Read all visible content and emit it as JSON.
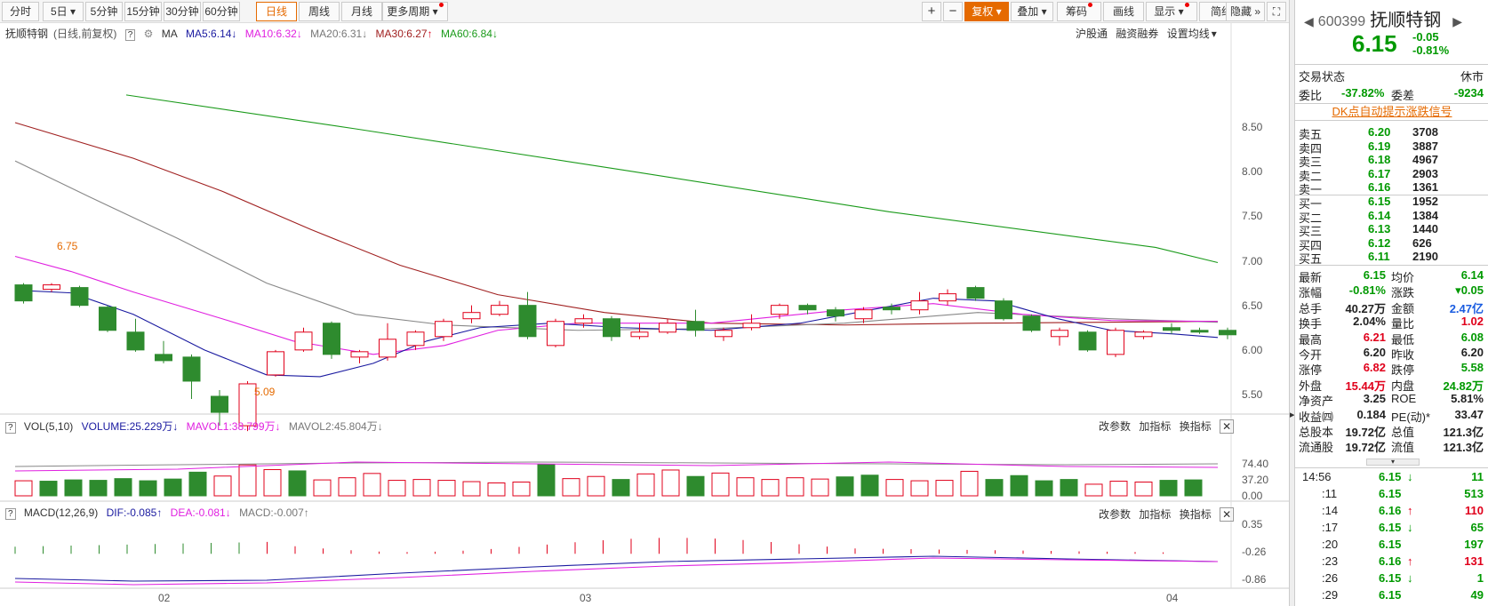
{
  "toolbar": {
    "periods": [
      "分时",
      "5日",
      "5分钟",
      "15分钟",
      "30分钟",
      "60分钟",
      "日线",
      "周线",
      "月线",
      "更多周期"
    ],
    "right_buttons": [
      "复权",
      "叠加",
      "筹码",
      "画线",
      "显示",
      "简约",
      "隐藏"
    ]
  },
  "main_legend": {
    "name": "抚顺特钢",
    "mode": "(日线,前复权)",
    "help": "?",
    "ma_label": "MA",
    "ma5": "MA5:6.14",
    "ma10": "MA10:6.32",
    "ma20": "MA20:6.31",
    "ma30": "MA30:6.27",
    "ma60": "MA60:6.84",
    "links": [
      "沪股通",
      "融资融券",
      "设置均线"
    ]
  },
  "price_axis": [
    "8.50",
    "8.00",
    "7.50",
    "7.00",
    "6.50",
    "6.00",
    "5.50"
  ],
  "annotations": {
    "high": "6.75",
    "low": "5.09"
  },
  "vol_legend": {
    "title": "VOL(5,10)",
    "volume": "VOLUME:25.229万",
    "mavol1": "MAVOL1:38.799万",
    "mavol2": "MAVOL2:45.804万",
    "buttons": [
      "改参数",
      "加指标",
      "换指标"
    ]
  },
  "vol_axis": [
    "74.40",
    "37.20",
    "0.00"
  ],
  "macd_legend": {
    "title": "MACD(12,26,9)",
    "dif": "DIF:-0.085",
    "dea": "DEA:-0.081",
    "macd": "MACD:-0.007",
    "buttons": [
      "改参数",
      "加指标",
      "换指标"
    ]
  },
  "macd_axis": [
    "0.35",
    "-0.26",
    "-0.86"
  ],
  "date_axis": [
    "02",
    "03",
    "04"
  ],
  "colors": {
    "up": "#e0001b",
    "down": "#2e8b2e",
    "ma5": "#1a1aa0",
    "ma10": "#e020e0",
    "ma20": "#888888",
    "ma30": "#a02020",
    "ma60": "#1a9a1a",
    "accent": "#e56a00"
  },
  "chart_data": {
    "type": "candlestick",
    "candles": [
      {
        "o": 6.73,
        "c": 6.55,
        "h": 6.75,
        "l": 6.52
      },
      {
        "o": 6.68,
        "c": 6.73,
        "h": 6.75,
        "l": 6.65
      },
      {
        "o": 6.7,
        "c": 6.5,
        "h": 6.72,
        "l": 6.48
      },
      {
        "o": 6.48,
        "c": 6.22,
        "h": 6.5,
        "l": 6.2
      },
      {
        "o": 6.2,
        "c": 6.0,
        "h": 6.35,
        "l": 5.98
      },
      {
        "o": 5.95,
        "c": 5.88,
        "h": 6.1,
        "l": 5.85
      },
      {
        "o": 5.92,
        "c": 5.65,
        "h": 5.95,
        "l": 5.45
      },
      {
        "o": 5.48,
        "c": 5.3,
        "h": 5.55,
        "l": 5.15
      },
      {
        "o": 5.15,
        "c": 5.62,
        "h": 5.65,
        "l": 5.09
      },
      {
        "o": 5.72,
        "c": 5.98,
        "h": 6.0,
        "l": 5.7
      },
      {
        "o": 6.0,
        "c": 6.2,
        "h": 6.25,
        "l": 5.98
      },
      {
        "o": 6.3,
        "c": 5.95,
        "h": 6.32,
        "l": 5.9
      },
      {
        "o": 5.92,
        "c": 5.98,
        "h": 6.0,
        "l": 5.85
      },
      {
        "o": 5.92,
        "c": 6.12,
        "h": 6.3,
        "l": 5.88
      },
      {
        "o": 6.05,
        "c": 6.2,
        "h": 6.22,
        "l": 6.0
      },
      {
        "o": 6.15,
        "c": 6.32,
        "h": 6.35,
        "l": 6.1
      },
      {
        "o": 6.35,
        "c": 6.42,
        "h": 6.5,
        "l": 6.3
      },
      {
        "o": 6.4,
        "c": 6.5,
        "h": 6.55,
        "l": 6.38
      },
      {
        "o": 6.5,
        "c": 6.15,
        "h": 6.65,
        "l": 6.12
      },
      {
        "o": 6.05,
        "c": 6.32,
        "h": 6.35,
        "l": 6.03
      },
      {
        "o": 6.3,
        "c": 6.35,
        "h": 6.4,
        "l": 6.25
      },
      {
        "o": 6.35,
        "c": 6.15,
        "h": 6.38,
        "l": 6.1
      },
      {
        "o": 6.15,
        "c": 6.2,
        "h": 6.3,
        "l": 6.12
      },
      {
        "o": 6.2,
        "c": 6.3,
        "h": 6.35,
        "l": 6.18
      },
      {
        "o": 6.32,
        "c": 6.22,
        "h": 6.45,
        "l": 6.15
      },
      {
        "o": 6.15,
        "c": 6.22,
        "h": 6.25,
        "l": 6.1
      },
      {
        "o": 6.25,
        "c": 6.3,
        "h": 6.4,
        "l": 6.22
      },
      {
        "o": 6.4,
        "c": 6.5,
        "h": 6.52,
        "l": 6.35
      },
      {
        "o": 6.5,
        "c": 6.45,
        "h": 6.52,
        "l": 6.4
      },
      {
        "o": 6.45,
        "c": 6.38,
        "h": 6.48,
        "l": 6.32
      },
      {
        "o": 6.35,
        "c": 6.45,
        "h": 6.48,
        "l": 6.3
      },
      {
        "o": 6.48,
        "c": 6.45,
        "h": 6.52,
        "l": 6.4
      },
      {
        "o": 6.45,
        "c": 6.55,
        "h": 6.65,
        "l": 6.4
      },
      {
        "o": 6.55,
        "c": 6.63,
        "h": 6.68,
        "l": 6.5
      },
      {
        "o": 6.7,
        "c": 6.58,
        "h": 6.72,
        "l": 6.55
      },
      {
        "o": 6.55,
        "c": 6.35,
        "h": 6.58,
        "l": 6.33
      },
      {
        "o": 6.38,
        "c": 6.22,
        "h": 6.4,
        "l": 6.2
      },
      {
        "o": 6.15,
        "c": 6.22,
        "h": 6.25,
        "l": 6.05
      },
      {
        "o": 6.2,
        "c": 6.0,
        "h": 6.22,
        "l": 5.98
      },
      {
        "o": 5.95,
        "c": 6.22,
        "h": 6.25,
        "l": 5.92
      },
      {
        "o": 6.15,
        "c": 6.2,
        "h": 6.22,
        "l": 6.12
      },
      {
        "o": 6.25,
        "c": 6.22,
        "h": 6.3,
        "l": 6.18
      },
      {
        "o": 6.22,
        "c": 6.2,
        "h": 6.25,
        "l": 6.18
      },
      {
        "o": 6.22,
        "c": 6.17,
        "h": 6.25,
        "l": 6.12
      }
    ],
    "volumes": [
      35,
      34,
      37,
      36,
      40,
      35,
      39,
      55,
      46,
      72,
      61,
      58,
      37,
      42,
      52,
      36,
      38,
      36,
      33,
      30,
      32,
      73,
      40,
      45,
      38,
      51,
      60,
      45,
      53,
      42,
      38,
      42,
      39,
      44,
      48,
      38,
      35,
      36,
      57,
      38,
      47,
      35,
      38,
      27,
      34,
      32,
      36,
      37
    ],
    "vol_colors": [
      "u",
      "d",
      "d",
      "d",
      "d",
      "d",
      "d",
      "d",
      "u",
      "u",
      "u",
      "d",
      "u",
      "u",
      "u",
      "u",
      "u",
      "u",
      "u",
      "u",
      "u",
      "d",
      "u",
      "u",
      "d",
      "u",
      "u",
      "d",
      "u",
      "u",
      "u",
      "u",
      "u",
      "d",
      "d",
      "u",
      "u",
      "u",
      "u",
      "d",
      "d",
      "d",
      "d",
      "u",
      "u",
      "u",
      "d",
      "d"
    ]
  },
  "quote": {
    "code": "600399",
    "name": "抚顺特钢",
    "price": "6.15",
    "change": "-0.05",
    "change_pct": "-0.81%",
    "trade_status_label": "交易状态",
    "trade_status": "休市",
    "weibi_label": "委比",
    "weibi": "-37.82%",
    "weicha_label": "委差",
    "weicha": "-9234",
    "signal_link": "DK点自动提示涨跌信号",
    "asks": [
      {
        "label": "卖五",
        "price": "6.20",
        "vol": "3708"
      },
      {
        "label": "卖四",
        "price": "6.19",
        "vol": "3887"
      },
      {
        "label": "卖三",
        "price": "6.18",
        "vol": "4967"
      },
      {
        "label": "卖二",
        "price": "6.17",
        "vol": "2903"
      },
      {
        "label": "卖一",
        "price": "6.16",
        "vol": "1361"
      }
    ],
    "bids": [
      {
        "label": "买一",
        "price": "6.15",
        "vol": "1952"
      },
      {
        "label": "买二",
        "price": "6.14",
        "vol": "1384"
      },
      {
        "label": "买三",
        "price": "6.13",
        "vol": "1440"
      },
      {
        "label": "买四",
        "price": "6.12",
        "vol": "626"
      },
      {
        "label": "买五",
        "price": "6.11",
        "vol": "2190"
      }
    ],
    "stats": [
      {
        "l1": "最新",
        "v1": "6.15",
        "c1": "green",
        "l2": "均价",
        "v2": "6.14",
        "c2": "green"
      },
      {
        "l1": "涨幅",
        "v1": "-0.81%",
        "c1": "green",
        "l2": "涨跌",
        "v2": "▾0.05",
        "c2": "green"
      },
      {
        "l1": "总手",
        "v1": "40.27万",
        "c1": "blk",
        "l2": "金额",
        "v2": "2.47亿",
        "c2": "blue"
      },
      {
        "l1": "换手",
        "v1": "2.04%",
        "c1": "blk",
        "l2": "量比",
        "v2": "1.02",
        "c2": "red"
      },
      {
        "l1": "最高",
        "v1": "6.21",
        "c1": "red",
        "l2": "最低",
        "v2": "6.08",
        "c2": "green"
      },
      {
        "l1": "今开",
        "v1": "6.20",
        "c1": "blk",
        "l2": "昨收",
        "v2": "6.20",
        "c2": "blk"
      },
      {
        "l1": "涨停",
        "v1": "6.82",
        "c1": "red",
        "l2": "跌停",
        "v2": "5.58",
        "c2": "green"
      },
      {
        "l1": "外盘",
        "v1": "15.44万",
        "c1": "red",
        "l2": "内盘",
        "v2": "24.82万",
        "c2": "green"
      },
      {
        "l1": "净资产",
        "v1": "3.25",
        "c1": "blk",
        "l2": "ROE",
        "v2": "5.81%",
        "c2": "blk"
      },
      {
        "l1": "收益㈣",
        "v1": "0.184",
        "c1": "blk",
        "l2": "PE(动)*",
        "v2": "33.47",
        "c2": "blk"
      },
      {
        "l1": "总股本",
        "v1": "19.72亿",
        "c1": "blk",
        "l2": "总值",
        "v2": "121.3亿",
        "c2": "blk"
      },
      {
        "l1": "流通股",
        "v1": "19.72亿",
        "c1": "blk",
        "l2": "流值",
        "v2": "121.3亿",
        "c2": "blk"
      }
    ],
    "ticks": [
      {
        "time": "14:56",
        "price": "6.15",
        "dir": "↓",
        "vol": "11",
        "pc": "green",
        "vc": "green"
      },
      {
        "time": ":11",
        "price": "6.15",
        "dir": "",
        "vol": "513",
        "pc": "green",
        "vc": "green"
      },
      {
        "time": ":14",
        "price": "6.16",
        "dir": "↑",
        "vol": "110",
        "pc": "green",
        "vc": "red"
      },
      {
        "time": ":17",
        "price": "6.15",
        "dir": "↓",
        "vol": "65",
        "pc": "green",
        "vc": "green"
      },
      {
        "time": ":20",
        "price": "6.15",
        "dir": "",
        "vol": "197",
        "pc": "green",
        "vc": "green"
      },
      {
        "time": ":23",
        "price": "6.16",
        "dir": "↑",
        "vol": "131",
        "pc": "green",
        "vc": "red"
      },
      {
        "time": ":26",
        "price": "6.15",
        "dir": "↓",
        "vol": "1",
        "pc": "green",
        "vc": "green"
      },
      {
        "time": ":29",
        "price": "6.15",
        "dir": "",
        "vol": "49",
        "pc": "green",
        "vc": "green"
      }
    ]
  }
}
